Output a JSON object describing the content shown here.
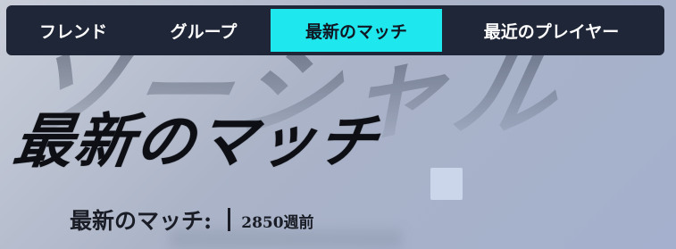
{
  "background": {
    "watermark_text": "ソーシャル"
  },
  "tabs": [
    {
      "label": "フレンド",
      "active": false
    },
    {
      "label": "グループ",
      "active": false
    },
    {
      "label": "最新のマッチ",
      "active": true
    },
    {
      "label": "最近のプレイヤー",
      "active": false
    }
  ],
  "header": {
    "title": "最新のマッチ"
  },
  "info": {
    "label": "最新のマッチ:",
    "value": "2850週前"
  },
  "colors": {
    "tab_bar_bg": "#1f2638",
    "active_tab_bg": "#1ee8ee",
    "text_dark": "#0d0f14"
  }
}
